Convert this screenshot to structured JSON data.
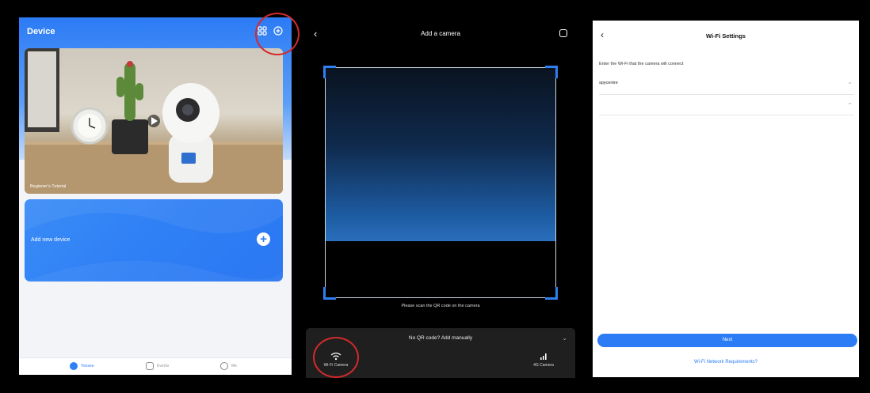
{
  "device_screen": {
    "title": "Device",
    "hero_caption": "Beginner's Tutorial",
    "add_card_label": "Add new device",
    "tabs": [
      {
        "label": "Yoosee",
        "active": true
      },
      {
        "label": "Events",
        "active": false
      },
      {
        "label": "Me",
        "active": false
      }
    ],
    "accent_color": "#2f7ff5"
  },
  "add_camera_screen": {
    "title": "Add a camera",
    "scan_tip": "Please scan the QR code on the camera",
    "sheet_title": "No QR code? Add manually",
    "options": [
      {
        "label": "Wi-Fi Camera",
        "icon": "wifi-icon"
      },
      {
        "label": "4G Camera",
        "icon": "signal-icon"
      }
    ]
  },
  "wifi_screen": {
    "title": "Wi-Fi Settings",
    "hint": "Enter the Wi-Fi that the camera will connect",
    "ssid_value": "spycentre",
    "password_value": "",
    "next_label": "Next",
    "requirements_link": "Wi-Fi Network Requirements?"
  },
  "annotation_color": "#d42a2a"
}
